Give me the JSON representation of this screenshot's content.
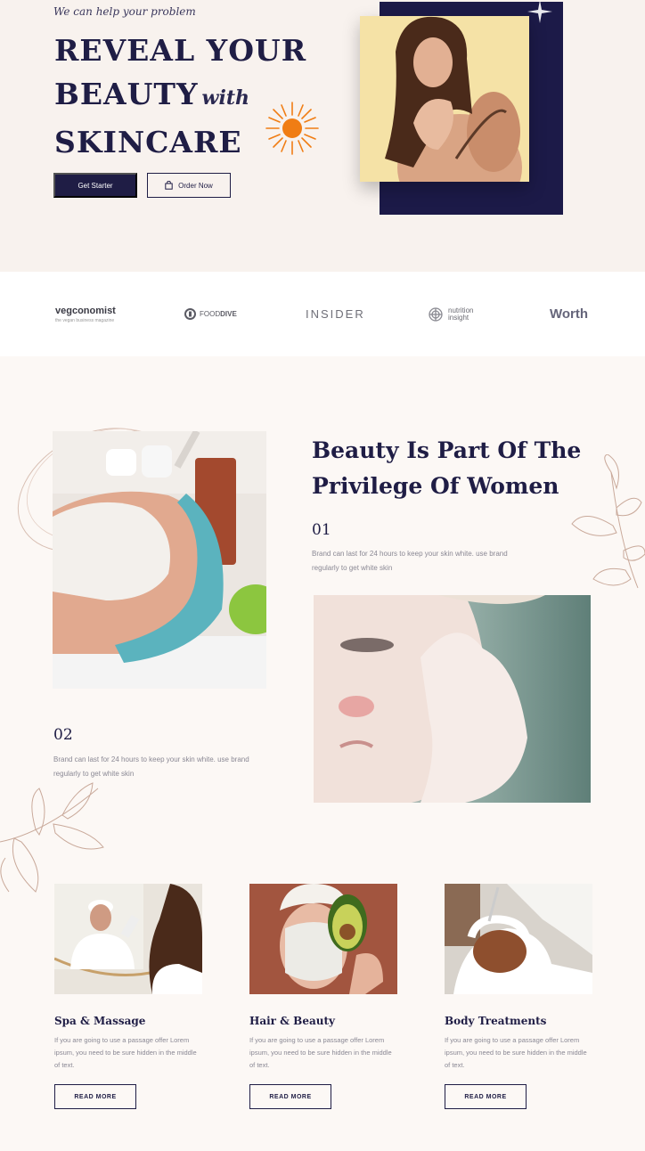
{
  "hero": {
    "tagline": "We can help your problem",
    "headline_line1": "REVEAL YOUR",
    "headline_line2": "BEAUTY",
    "headline_with": "with",
    "headline_line3": "SKINCARE",
    "primary_button": "Get Starter",
    "secondary_button": "Order Now",
    "secondary_button_icon": "shopping-bag-icon"
  },
  "logos": {
    "vegconomist": "vegconomist",
    "vegconomist_sub": "the vegan business magazine",
    "fooddive_a": "FOOD",
    "fooddive_b": "DIVE",
    "insider": "INSIDER",
    "nutrition_line1": "nutrition",
    "nutrition_line2": "insight",
    "worth": "Worth"
  },
  "feature": {
    "title_line1": "Beauty Is Part Of The",
    "title_line2": "Privilege Of Women",
    "items": [
      {
        "number": "01",
        "text": "Brand can last for 24 hours to keep your skin white. use brand regularly to get white skin"
      },
      {
        "number": "02",
        "text": "Brand can last for 24 hours to keep your skin white. use brand regularly to get white skin"
      }
    ]
  },
  "services": [
    {
      "title": "Spa & Massage",
      "text": "If you are going to use a passage offer Lorem ipsum, you need to be sure hidden in the middle of text.",
      "button": "READ MORE"
    },
    {
      "title": "Hair & Beauty",
      "text": "If you are going to use a passage offer Lorem ipsum, you need to be sure hidden in the middle of text.",
      "button": "READ MORE"
    },
    {
      "title": "Body Treatments",
      "text": "If you are going to use a passage offer Lorem ipsum, you need to be sure hidden in the middle of text.",
      "button": "READ MORE"
    }
  ],
  "colors": {
    "navy": "#1f1d45",
    "accent_orange": "#f07d14",
    "hero_bg": "#f8f2ee",
    "photo_yellow": "#f5e2a6"
  }
}
